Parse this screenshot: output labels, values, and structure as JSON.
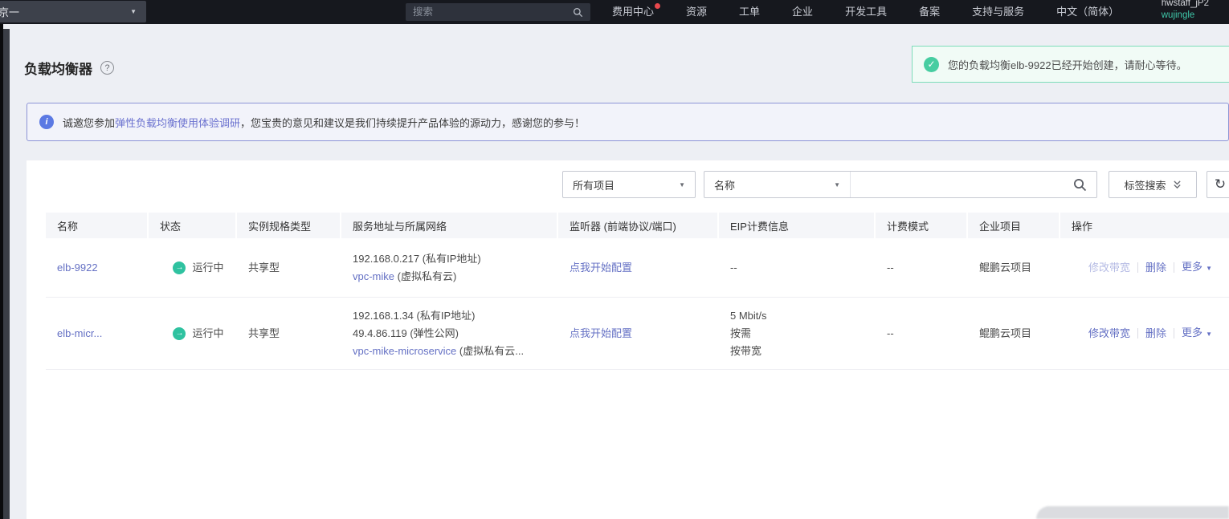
{
  "colors": {
    "navbar_bg": "#16181e",
    "link": "#6470c4",
    "status_green": "#2fc2a0",
    "toast_border": "#7edcba",
    "banner_border": "#8d94d6",
    "banner_link": "#6a71cf",
    "badge_red": "#e8484d",
    "username_teal": "#3ec6a8"
  },
  "topnav": {
    "region_label": "京一",
    "search_placeholder": "搜索",
    "items": [
      {
        "label": "费用中心"
      },
      {
        "label": "资源"
      },
      {
        "label": "工单"
      },
      {
        "label": "企业"
      },
      {
        "label": "开发工具"
      },
      {
        "label": "备案"
      },
      {
        "label": "支持与服务"
      },
      {
        "label": "中文（简体）"
      }
    ],
    "account": "hwstaff_jP2",
    "username": "wujingle"
  },
  "page": {
    "title": "负载均衡器",
    "help_glyph": "?"
  },
  "toast": {
    "message": "您的负载均衡elb-9922已经开始创建，请耐心等待。",
    "check_glyph": "✓"
  },
  "banner": {
    "icon_glyph": "i",
    "text_before": "诚邀您参加",
    "link": "弹性负载均衡使用体验调研",
    "text_after": "，您宝贵的意见和建议是我们持续提升产品体验的源动力，感谢您的参与！"
  },
  "filters": {
    "project_select": "所有项目",
    "field_select": "名称",
    "search_value": "",
    "tag_search_label": "标签搜索",
    "refresh_glyph": "↻"
  },
  "table": {
    "headers": [
      "名称",
      "状态",
      "实例规格类型",
      "服务地址与所属网络",
      "监听器 (前端协议/端口)",
      "EIP计费信息",
      "计费模式",
      "企业项目",
      "操作"
    ],
    "rows": [
      {
        "name": "elb-9922",
        "status": "运行中",
        "spec": "共享型",
        "addr_line1": "192.168.0.217 (私有IP地址)",
        "vpc_link": "vpc-mike",
        "vpc_suffix": " (虚拟私有云)",
        "listener": "点我开始配置",
        "eip_line1": "--",
        "billing_mode": "--",
        "enterprise_project": "鲲鹏云项目",
        "action_modify": "修改带宽",
        "action_delete": "删除",
        "action_more": "更多"
      },
      {
        "name": "elb-micr...",
        "status": "运行中",
        "spec": "共享型",
        "addr_line1": "192.168.1.34 (私有IP地址)",
        "addr_line2": "49.4.86.119 (弹性公网)",
        "vpc_link": "vpc-mike-microservice",
        "vpc_suffix": " (虚拟私有云...",
        "listener": "点我开始配置",
        "eip_line1": "5 Mbit/s",
        "eip_line2": "按需",
        "eip_line3": "按带宽",
        "billing_mode": "--",
        "enterprise_project": "鲲鹏云项目",
        "action_modify": "修改带宽",
        "action_delete": "删除",
        "action_more": "更多"
      }
    ]
  }
}
